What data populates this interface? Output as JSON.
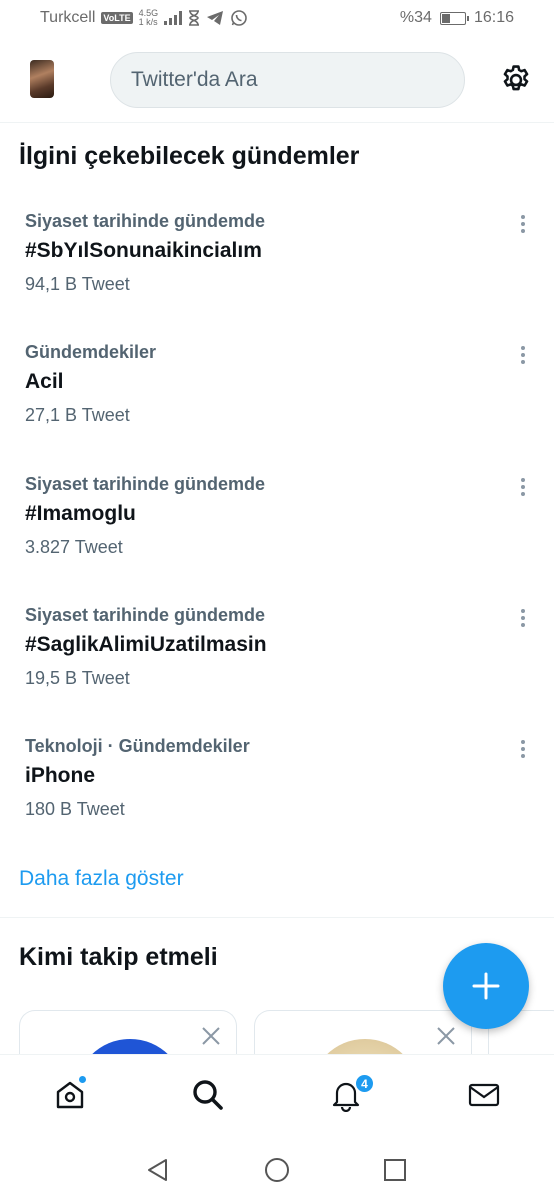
{
  "status_bar": {
    "carrier": "Turkcell",
    "volte": "VoLTE",
    "network": "4.5G",
    "network_speed": "1 k/s",
    "battery": "%34",
    "battery_level": 0.34,
    "time": "16:16"
  },
  "header": {
    "search_placeholder": "Twitter'da Ara"
  },
  "trends": {
    "title": "İlgini çekebilecek gündemler",
    "items": [
      {
        "category": "Siyaset tarihinde gündemde",
        "name": "#SbYılSonunaikincialım",
        "count": "94,1 B Tweet"
      },
      {
        "category": "Gündemdekiler",
        "name": "Acil",
        "count": "27,1 B Tweet"
      },
      {
        "category": "Siyaset tarihinde gündemde",
        "name": "#Imamoglu",
        "count": "3.827 Tweet"
      },
      {
        "category": "Siyaset tarihinde gündemde",
        "name": "#SaglikAlimiUzatilmasin",
        "count": "19,5 B Tweet"
      },
      {
        "category": "Teknoloji · Gündemdekiler",
        "name": "iPhone",
        "count": "180 B Tweet"
      }
    ],
    "show_more": "Daha fazla göster"
  },
  "who_to_follow": {
    "title": "Kimi takip etmeli"
  },
  "bottom_nav": {
    "notifications_badge": "4"
  },
  "colors": {
    "accent": "#1d9bf0",
    "text_primary": "#0f1419",
    "text_secondary": "#536471"
  }
}
